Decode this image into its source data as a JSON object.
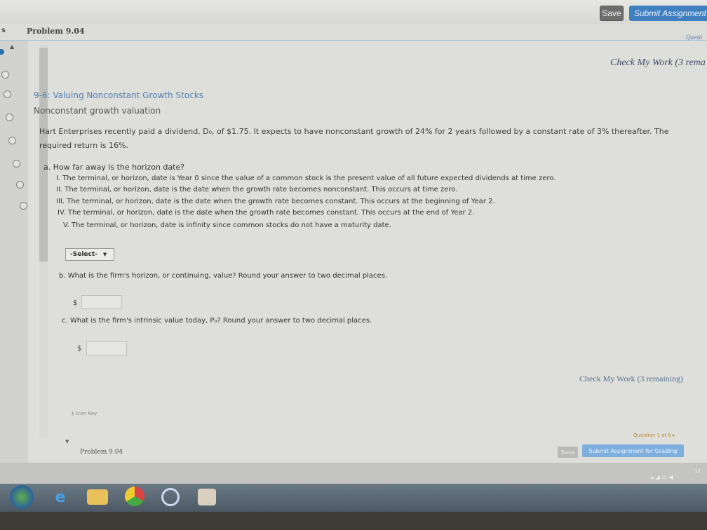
{
  "toolbar": {
    "save_label": "Save",
    "submit_label": "Submit Assignment f"
  },
  "header": {
    "left_edge": "s",
    "problem_title": "Problem 9.04",
    "question_nav": "Questi"
  },
  "check_work_top": "Check My Work (3 rema",
  "problem": {
    "section_title": "9-6: Valuing Nonconstant Growth Stocks",
    "subtitle": "Nonconstant growth valuation",
    "text": "Hart Enterprises recently paid a dividend, D₀, of $1.75. It expects to have nonconstant growth of 24% for 2 years followed by a constant rate of 3% thereafter. The\nrequired return is 16%."
  },
  "part_a": {
    "prompt": "a. How far away is the horizon date?",
    "options": [
      "I. The terminal, or horizon, date is Year 0 since the value of a common stock is the present value of all future expected dividends at time zero.",
      "II. The terminal, or horizon, date is the date when the growth rate becomes nonconstant. This occurs at time zero.",
      "III. The terminal, or horizon, date is the date when the growth rate becomes constant. This occurs at the beginning of Year 2.",
      "IV. The terminal, or horizon, date is the date when the growth rate becomes constant. This occurs at the end of Year 2.",
      "V. The terminal, or horizon, date is infinity since common stocks do not have a maturity date."
    ],
    "select_value": "-Select-"
  },
  "part_b": {
    "prompt": "b. What is the firm's horizon, or continuing, value? Round your answer to two decimal places.",
    "currency": "$"
  },
  "part_c": {
    "prompt": "c. What is the firm's intrinsic value today, P₀? Round your answer to two decimal places.",
    "currency": "$"
  },
  "check_work_bottom": "Check My Work (3 remaining)",
  "footer": {
    "icon_key": "Icon Key",
    "question_count": "Question 1 of 8 ▸",
    "problem_title": "Problem 9.04",
    "save_label": "Save",
    "submit_label": "Submit Assignment for Grading"
  },
  "taskbar": {
    "clock": "12"
  },
  "icons": [
    "arrow-up-icon",
    "radio-icon",
    "key-icon",
    "windows-start-icon",
    "ie-icon",
    "folder-icon",
    "chrome-icon",
    "media-icon",
    "app-icon",
    "volume-icon"
  ]
}
